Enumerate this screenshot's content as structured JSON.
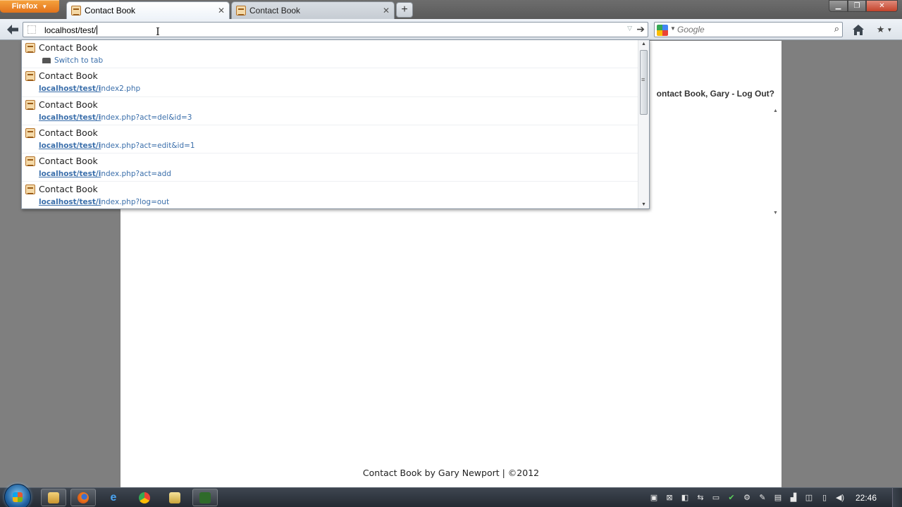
{
  "browser": {
    "menu_button": "Firefox",
    "tabs": [
      {
        "label": "Contact Book",
        "active": true
      },
      {
        "label": "Contact Book",
        "active": false
      }
    ],
    "new_tab_label": "+",
    "url": "localhost/test/",
    "search_placeholder": "Google",
    "search_engine_icon": "google-icon"
  },
  "autocomplete": {
    "typed_match": "localhost/test/i",
    "items": [
      {
        "title": "Contact Book",
        "switch_to_tab": "Switch to tab",
        "url": ""
      },
      {
        "title": "Contact Book",
        "url_match": "localhost/test/i",
        "url_rest": "ndex2.php"
      },
      {
        "title": "Contact Book",
        "url_match": "localhost/test/i",
        "url_rest": "ndex.php?act=del&id=3"
      },
      {
        "title": "Contact Book",
        "url_match": "localhost/test/i",
        "url_rest": "ndex.php?act=edit&id=1"
      },
      {
        "title": "Contact Book",
        "url_match": "localhost/test/i",
        "url_rest": "ndex.php?act=add"
      },
      {
        "title": "Contact Book",
        "url_match": "localhost/test/i",
        "url_rest": "ndex.php?log=out"
      }
    ]
  },
  "page": {
    "welcome": "ontact Book, Gary - Log Out?",
    "footer": "Contact Book by Gary Newport | ©2012"
  },
  "taskbar": {
    "apps": [
      "explorer-icon",
      "firefox-icon",
      "ie-icon",
      "chrome-icon",
      "media-icon",
      "dreamweaver-icon"
    ],
    "clock": "22:46"
  },
  "colors": {
    "firefox_orange": "#e2731b",
    "link_blue": "#3b6fab",
    "chrome_gray": "#7f7f7f"
  }
}
